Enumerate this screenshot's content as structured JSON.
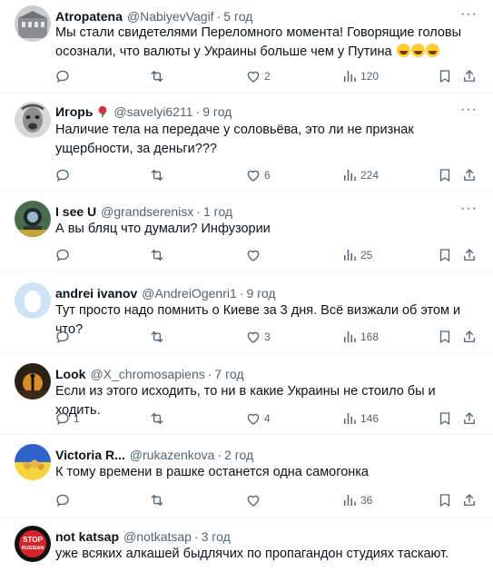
{
  "colors": {
    "text": "#0f1419",
    "muted": "#536471",
    "divider": "#eff3f4"
  },
  "tweets": [
    {
      "name": "Atropatena",
      "handle": "@NabiyevVagif",
      "time": "5 год",
      "text": "Мы стали свидетелями Переломного момента!  Говорящие головы осознали, что валюты у Украины больше чем у Путина",
      "emoji": [
        "rofl",
        "rofl",
        "rofl"
      ],
      "replies": "",
      "retweets": "",
      "likes": "2",
      "views": "120",
      "avatar": "building-photo"
    },
    {
      "name": "Игорь",
      "handle": "@savelyi6211",
      "time": "9 год",
      "text": "Наличие тела на передаче у соловьёва, это ли не признак ущербности, за деньги???",
      "replies": "",
      "retweets": "",
      "likes": "6",
      "views": "224",
      "avatar": "bw-face-photo"
    },
    {
      "name": "I see U",
      "handle": "@grandserenisx",
      "time": "1 год",
      "text": "А вы бляц что думали? Инфузории",
      "replies": "",
      "retweets": "",
      "likes": "",
      "views": "25",
      "avatar": "diver-photo"
    },
    {
      "name": "andrei ivanov",
      "handle": "@AndreiOgenri1",
      "time": "9 год",
      "text": "Тут просто надо помнить о Киеве за 3 дня. Всё визжали об этом и что?",
      "replies": "",
      "retweets": "",
      "likes": "3",
      "views": "168",
      "avatar": "default-egg"
    },
    {
      "name": "Look",
      "handle": "@X_chromosapiens",
      "time": "7 год",
      "text": "Если из этого исходить, то ни в какие Украины не стоило бы и ходить.",
      "replies": "1",
      "retweets": "",
      "likes": "4",
      "views": "146",
      "avatar": "sunset-figure-photo"
    },
    {
      "name": "Victoria R...",
      "handle": "@rukazenkova",
      "time": "2 год",
      "text": "К тому времени в рашке останется одна самогонка",
      "replies": "",
      "retweets": "",
      "likes": "",
      "views": "36",
      "avatar": "ukraine-flag-flowers"
    },
    {
      "name": "not katsap",
      "handle": "@notkatsap",
      "time": "3 год",
      "text": "уже всяких алкашей быдлячих по пропагандон студиях таскают.",
      "replies": "",
      "retweets": "",
      "likes": "",
      "views": "",
      "avatar": "stop-russian-logo",
      "avatar_text": [
        "STOP",
        "RUSSIAN"
      ]
    }
  ]
}
